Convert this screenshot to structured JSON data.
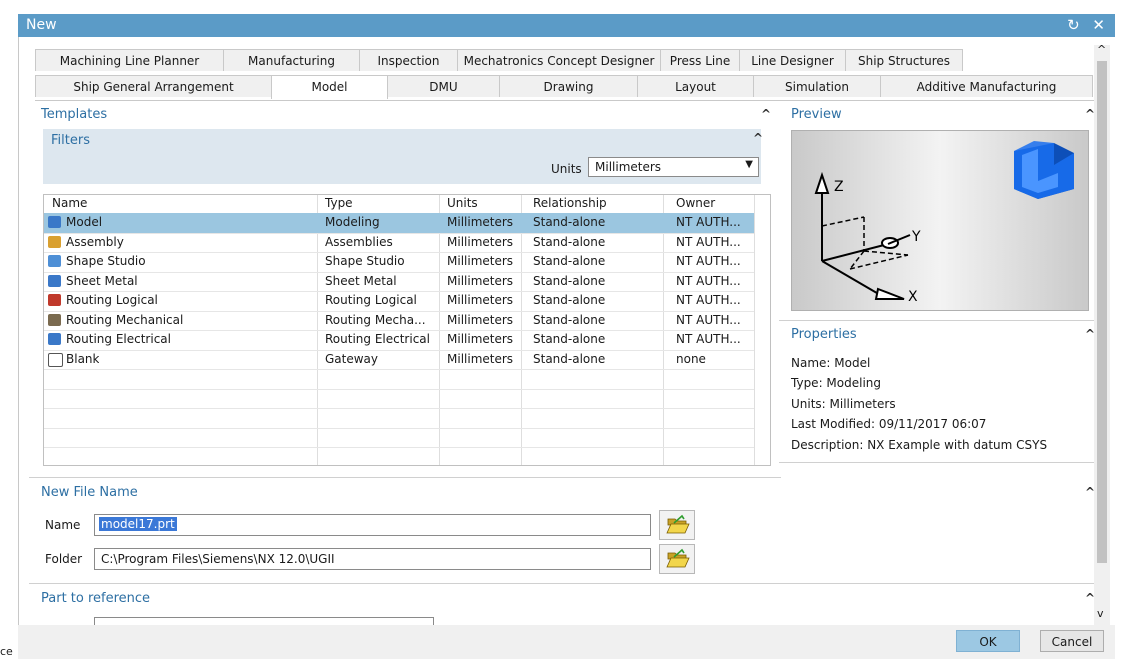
{
  "window": {
    "title": "New",
    "controls": "↻ ✕"
  },
  "tabs_row1": [
    "Machining Line Planner",
    "Manufacturing",
    "Inspection",
    "Mechatronics Concept Designer",
    "Press Line",
    "Line Designer",
    "Ship Structures"
  ],
  "tabs_row2": [
    "Ship General Arrangement",
    "Model",
    "DMU",
    "Drawing",
    "Layout",
    "Simulation",
    "Additive Manufacturing"
  ],
  "active_tab": "Model",
  "templates": {
    "title": "Templates",
    "filters_title": "Filters",
    "units_label": "Units",
    "units_value": "Millimeters",
    "columns": [
      "Name",
      "Type",
      "Units",
      "Relationship",
      "Owner"
    ],
    "rows": [
      [
        "Model",
        "Modeling",
        "Millimeters",
        "Stand-alone",
        "NT AUTH..."
      ],
      [
        "Assembly",
        "Assemblies",
        "Millimeters",
        "Stand-alone",
        "NT AUTH..."
      ],
      [
        "Shape Studio",
        "Shape Studio",
        "Millimeters",
        "Stand-alone",
        "NT AUTH..."
      ],
      [
        "Sheet Metal",
        "Sheet Metal",
        "Millimeters",
        "Stand-alone",
        "NT AUTH..."
      ],
      [
        "Routing Logical",
        "Routing Logical",
        "Millimeters",
        "Stand-alone",
        "NT AUTH..."
      ],
      [
        "Routing Mechanical",
        "Routing Mecha...",
        "Millimeters",
        "Stand-alone",
        "NT AUTH..."
      ],
      [
        "Routing Electrical",
        "Routing Electrical",
        "Millimeters",
        "Stand-alone",
        "NT AUTH..."
      ],
      [
        "Blank",
        "Gateway",
        "Millimeters",
        "Stand-alone",
        "none"
      ]
    ]
  },
  "preview": {
    "title": "Preview",
    "axis_z": "Z",
    "axis_y": "Y",
    "axis_x": "X"
  },
  "properties": {
    "title": "Properties",
    "name": "Name: Model",
    "type": "Type: Modeling",
    "units": "Units: Millimeters",
    "modified": "Last Modified: 09/11/2017 06:07",
    "description": "Description: NX Example with datum CSYS"
  },
  "new_file": {
    "title": "New File Name",
    "name_label": "Name",
    "name_value": "model17.prt",
    "folder_label": "Folder",
    "folder_value": "C:\\Program Files\\Siemens\\NX 12.0\\UGII"
  },
  "part_ref": {
    "title": "Part to reference"
  },
  "buttons": {
    "ok": "OK",
    "cancel": "Cancel"
  },
  "edge_text": "ce",
  "colors": {
    "accent": "#5b9bc7",
    "section_title": "#2d6fa3",
    "selected_row": "#9bc6e0"
  }
}
